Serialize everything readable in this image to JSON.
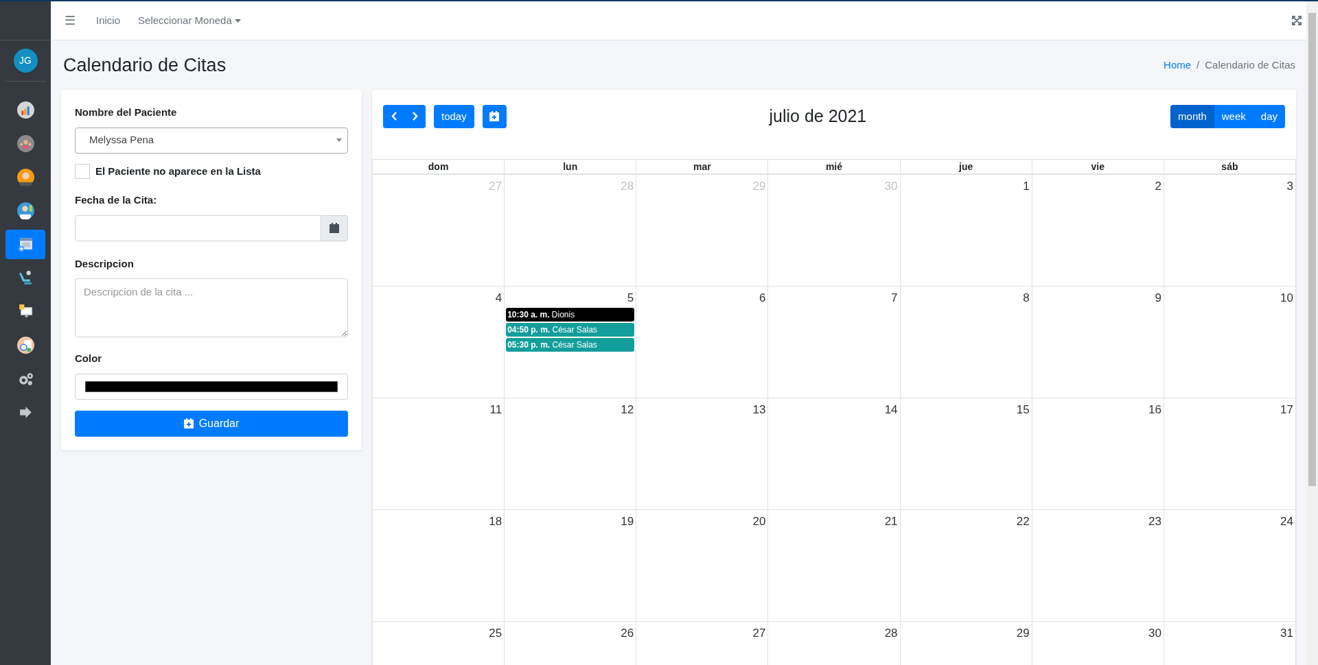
{
  "sidebar": {
    "avatar": "JG",
    "items": [
      {
        "kind": "chart",
        "selected": false
      },
      {
        "kind": "group",
        "selected": false
      },
      {
        "kind": "person",
        "selected": false
      },
      {
        "kind": "doctor",
        "selected": false
      },
      {
        "kind": "calendar",
        "selected": true
      },
      {
        "kind": "chair",
        "selected": false
      },
      {
        "kind": "monitor",
        "selected": false
      },
      {
        "kind": "clock",
        "selected": false
      },
      {
        "kind": "gears",
        "selected": false
      },
      {
        "kind": "logout",
        "selected": false
      }
    ]
  },
  "navbar": {
    "menu_icon": "☰",
    "links": [
      "Inicio",
      "Seleccionar Moneda"
    ]
  },
  "page_title": "Calendario de Citas",
  "breadcrumb": [
    "Home",
    "Calendario de Citas"
  ],
  "breadcrumb_separator": "/",
  "form": {
    "patient_label": "Nombre del Paciente",
    "patient_value": "Melyssa Pena",
    "checkbox": {
      "label": "El Paciente no aparece en la Lista",
      "checked": false
    },
    "date_label": "Fecha de la Cita:",
    "description_label": "Descripcion",
    "description_placeholder": "Descripcion de la cita ...",
    "color_label": "Color",
    "color": "#000000",
    "save_button": "Guardar"
  },
  "calendar": {
    "today_button": "today",
    "title": "julio de 2021",
    "views": [
      {
        "label": "month",
        "selected": true
      },
      {
        "label": "week",
        "selected": false
      },
      {
        "label": "day",
        "selected": false
      }
    ],
    "weekdays": [
      "dom",
      "lun",
      "mar",
      "mié",
      "jue",
      "vie",
      "sáb"
    ],
    "weeks": [
      [
        {
          "day": "27",
          "other_month": true
        },
        {
          "day": "28",
          "other_month": true
        },
        {
          "day": "29",
          "other_month": true
        },
        {
          "day": "30",
          "other_month": true
        },
        {
          "day": "1",
          "other_month": false
        },
        {
          "day": "2",
          "other_month": false
        },
        {
          "day": "3",
          "other_month": false
        }
      ],
      [
        {
          "day": "4",
          "other_month": false
        },
        {
          "day": "5",
          "other_month": false,
          "events": [
            {
              "time": "10:30 a. m.",
              "title": "Dionis",
              "color": "#000000"
            },
            {
              "time": "04:50 p. m.",
              "title": "César Salas",
              "color": "#139e9c"
            },
            {
              "time": "05:30 p. m.",
              "title": "César Salas",
              "color": "#139e9c"
            }
          ]
        },
        {
          "day": "6",
          "other_month": false
        },
        {
          "day": "7",
          "other_month": false
        },
        {
          "day": "8",
          "other_month": false
        },
        {
          "day": "9",
          "other_month": false
        },
        {
          "day": "10",
          "other_month": false
        }
      ],
      [
        {
          "day": "11",
          "other_month": false
        },
        {
          "day": "12",
          "other_month": false
        },
        {
          "day": "13",
          "other_month": false
        },
        {
          "day": "14",
          "other_month": false
        },
        {
          "day": "15",
          "other_month": false
        },
        {
          "day": "16",
          "other_month": false
        },
        {
          "day": "17",
          "other_month": false
        }
      ],
      [
        {
          "day": "18",
          "other_month": false
        },
        {
          "day": "19",
          "other_month": false
        },
        {
          "day": "20",
          "other_month": false
        },
        {
          "day": "21",
          "other_month": false
        },
        {
          "day": "22",
          "other_month": false
        },
        {
          "day": "23",
          "other_month": false
        },
        {
          "day": "24",
          "other_month": false
        }
      ],
      [
        {
          "day": "25",
          "other_month": false
        },
        {
          "day": "26",
          "other_month": false
        },
        {
          "day": "27",
          "other_month": false
        },
        {
          "day": "28",
          "other_month": false
        },
        {
          "day": "29",
          "other_month": false
        },
        {
          "day": "30",
          "other_month": false
        },
        {
          "day": "31",
          "other_month": false
        }
      ]
    ]
  }
}
